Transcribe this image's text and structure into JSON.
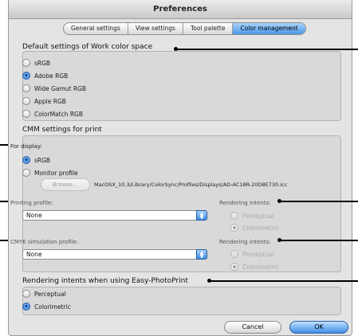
{
  "window": {
    "title": "Preferences"
  },
  "tabs": [
    {
      "label": "General settings",
      "active": false
    },
    {
      "label": "View settings",
      "active": false
    },
    {
      "label": "Tool palette",
      "active": false
    },
    {
      "label": "Color management",
      "active": true
    }
  ],
  "work_color_space": {
    "title": "Default settings of Work color space",
    "options": [
      {
        "label": "sRGB",
        "selected": false
      },
      {
        "label": "Adobe RGB",
        "selected": true
      },
      {
        "label": "Wide Gamut RGB",
        "selected": false
      },
      {
        "label": "Apple RGB",
        "selected": false
      },
      {
        "label": "ColorMatch RGB",
        "selected": false
      }
    ]
  },
  "cmm": {
    "title": "CMM settings for print",
    "for_display_label": "For display:",
    "display_options": [
      {
        "label": "sRGB",
        "selected": true
      },
      {
        "label": "Monitor profile",
        "selected": false
      }
    ],
    "browse_label": "Browse...",
    "monitor_profile_path": "MacOSX_10.3/Library/ColorSync/Profiles/Displays/AD-AC18R-20D8E730.icc",
    "printing_profile": {
      "label": "Printing profile:",
      "value": "None",
      "intents_label": "Rendering intents:",
      "intents": [
        {
          "label": "Perceptual",
          "selected": false
        },
        {
          "label": "Colorimetric",
          "selected": true
        }
      ]
    },
    "cmyk_profile": {
      "label": "CMYK simulation profile:",
      "value": "None",
      "intents_label": "Rendering intents:",
      "intents": [
        {
          "label": "Perceptual",
          "selected": false
        },
        {
          "label": "Colorimetric",
          "selected": true
        }
      ]
    }
  },
  "easy_photoprint": {
    "title": "Rendering intents when using Easy-PhotoPrint",
    "options": [
      {
        "label": "Perceptual",
        "selected": false
      },
      {
        "label": "Colorimetric",
        "selected": true
      }
    ]
  },
  "buttons": {
    "cancel": "Cancel",
    "ok": "OK"
  }
}
